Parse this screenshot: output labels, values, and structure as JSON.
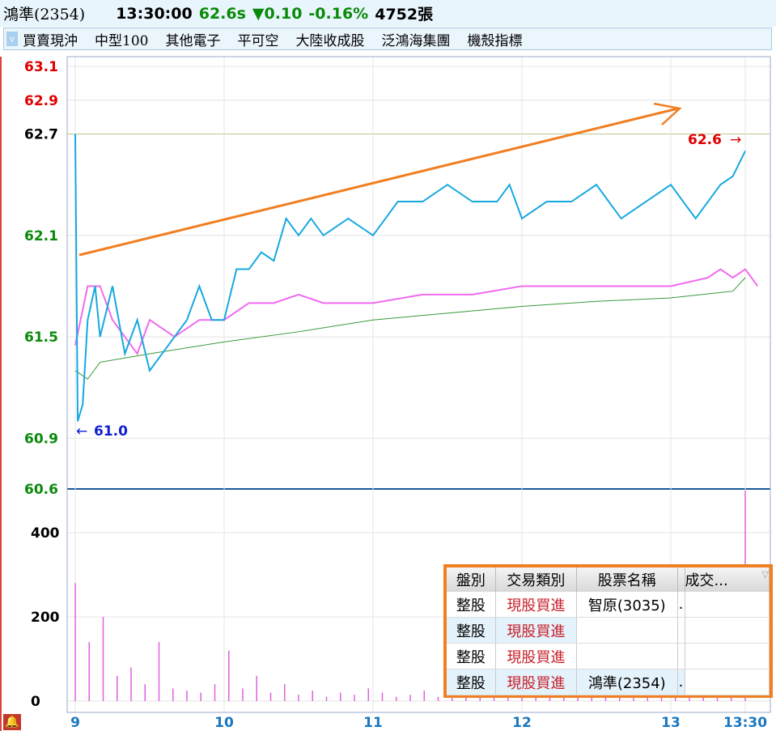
{
  "header": {
    "stock": "鴻準(2354)",
    "time": "13:30:00",
    "price": "62.6s",
    "change": "0.10",
    "change_pct": "-0.16%",
    "volume": "4752張"
  },
  "toolbar": {
    "items": [
      "買賣現沖",
      "中型100",
      "其他電子",
      "平可空",
      "大陸收成股",
      "泛鴻海集團",
      "機殼指標"
    ]
  },
  "colors": {
    "up": "#e00000",
    "down": "#008000",
    "price_line": "#17a8e0",
    "pink_line": "#f06af0",
    "avg_line": "#3a9a3a",
    "annotation": "#f07f22"
  },
  "chart_data": {
    "type": "line",
    "x_ticks": [
      "9",
      "10",
      "11",
      "12",
      "13",
      "13:30"
    ],
    "y_ticks": [
      {
        "v": 63.1,
        "label": "63.1",
        "color": "red"
      },
      {
        "v": 62.9,
        "label": "62.9",
        "color": "red"
      },
      {
        "v": 62.7,
        "label": "62.7",
        "color": "black"
      },
      {
        "v": 62.1,
        "label": "62.1",
        "color": "green"
      },
      {
        "v": 61.5,
        "label": "61.5",
        "color": "green"
      },
      {
        "v": 60.9,
        "label": "60.9",
        "color": "green"
      },
      {
        "v": 60.6,
        "label": "60.6",
        "color": "green"
      }
    ],
    "vol_ticks": [
      "400",
      "200",
      "0"
    ],
    "ylim": [
      60.6,
      63.1
    ],
    "vol_lim": [
      0,
      500
    ],
    "price": [
      [
        0,
        62.7
      ],
      [
        1,
        61.0
      ],
      [
        3,
        61.1
      ],
      [
        5,
        61.6
      ],
      [
        8,
        61.8
      ],
      [
        10,
        61.5
      ],
      [
        15,
        61.8
      ],
      [
        20,
        61.4
      ],
      [
        25,
        61.6
      ],
      [
        30,
        61.3
      ],
      [
        35,
        61.4
      ],
      [
        40,
        61.5
      ],
      [
        45,
        61.6
      ],
      [
        50,
        61.8
      ],
      [
        55,
        61.6
      ],
      [
        60,
        61.6
      ],
      [
        65,
        61.9
      ],
      [
        70,
        61.9
      ],
      [
        75,
        62.0
      ],
      [
        80,
        61.95
      ],
      [
        85,
        62.2
      ],
      [
        90,
        62.1
      ],
      [
        95,
        62.2
      ],
      [
        100,
        62.1
      ],
      [
        110,
        62.2
      ],
      [
        120,
        62.1
      ],
      [
        130,
        62.3
      ],
      [
        140,
        62.3
      ],
      [
        150,
        62.4
      ],
      [
        160,
        62.3
      ],
      [
        170,
        62.3
      ],
      [
        175,
        62.4
      ],
      [
        180,
        62.2
      ],
      [
        190,
        62.3
      ],
      [
        200,
        62.3
      ],
      [
        210,
        62.4
      ],
      [
        220,
        62.2
      ],
      [
        230,
        62.3
      ],
      [
        240,
        62.4
      ],
      [
        250,
        62.2
      ],
      [
        255,
        62.3
      ],
      [
        260,
        62.4
      ],
      [
        265,
        62.45
      ],
      [
        270,
        62.6
      ]
    ],
    "pink": [
      [
        0,
        61.45
      ],
      [
        5,
        61.8
      ],
      [
        10,
        61.8
      ],
      [
        15,
        61.6
      ],
      [
        20,
        61.5
      ],
      [
        25,
        61.4
      ],
      [
        30,
        61.6
      ],
      [
        40,
        61.5
      ],
      [
        50,
        61.6
      ],
      [
        60,
        61.6
      ],
      [
        70,
        61.7
      ],
      [
        80,
        61.7
      ],
      [
        90,
        61.75
      ],
      [
        100,
        61.7
      ],
      [
        120,
        61.7
      ],
      [
        140,
        61.75
      ],
      [
        160,
        61.75
      ],
      [
        180,
        61.8
      ],
      [
        200,
        61.8
      ],
      [
        220,
        61.8
      ],
      [
        240,
        61.8
      ],
      [
        255,
        61.85
      ],
      [
        260,
        61.9
      ],
      [
        265,
        61.85
      ],
      [
        270,
        61.9
      ],
      [
        275,
        61.8
      ]
    ],
    "avg": [
      [
        0,
        61.3
      ],
      [
        5,
        61.25
      ],
      [
        10,
        61.35
      ],
      [
        30,
        61.4
      ],
      [
        60,
        61.47
      ],
      [
        90,
        61.53
      ],
      [
        120,
        61.6
      ],
      [
        150,
        61.64
      ],
      [
        180,
        61.68
      ],
      [
        210,
        61.71
      ],
      [
        240,
        61.73
      ],
      [
        265,
        61.77
      ],
      [
        270,
        61.85
      ]
    ],
    "volume": [
      280,
      140,
      200,
      60,
      80,
      40,
      140,
      30,
      25,
      20,
      40,
      120,
      30,
      60,
      20,
      40,
      15,
      25,
      10,
      20,
      15,
      30,
      20,
      10,
      15,
      25,
      10,
      20,
      10,
      15,
      10,
      20,
      10,
      80,
      10,
      15,
      20,
      10,
      15,
      10,
      20,
      10,
      10,
      15,
      10,
      10,
      10,
      10,
      500
    ],
    "annotations": {
      "high": "62.6",
      "low": "61.0"
    }
  },
  "table": {
    "headers": [
      "盤別",
      "交易類別",
      "股票名稱",
      "成交..."
    ],
    "rows": [
      [
        "整股",
        "現股買進",
        "智原(3035)"
      ],
      [
        "整股",
        "現股買進",
        ""
      ],
      [
        "整股",
        "現股買進",
        ""
      ],
      [
        "整股",
        "現股買進",
        "鴻準(2354)"
      ]
    ]
  }
}
